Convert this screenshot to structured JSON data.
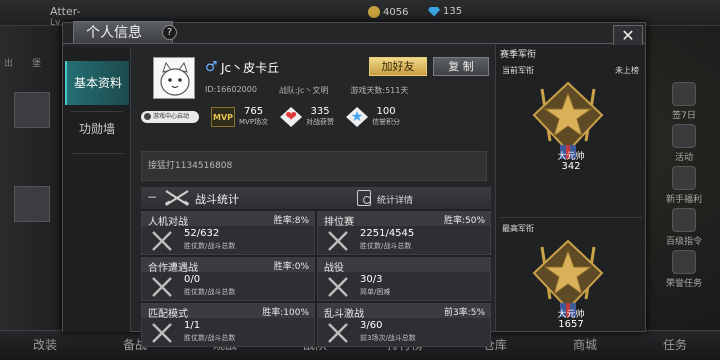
{
  "background": {
    "player_name": "Atter-",
    "player_level": "Lv.",
    "coins": "4056",
    "gems": "135",
    "left_tabs": [
      "出",
      "堡"
    ],
    "right_items": [
      "签7日",
      "活动",
      "新手福利",
      "百级指令",
      "荣誉任务"
    ],
    "bottom_items": [
      "改装",
      "备战",
      "观战",
      "战队",
      "排行榜",
      "仓库",
      "商城",
      "任务"
    ]
  },
  "dialog": {
    "title": "个人信息",
    "help_symbol": "?",
    "close_symbol": "✕",
    "side_tabs": [
      {
        "label": "基本资料",
        "active": true
      },
      {
        "label": "功勋墙",
        "active": false
      }
    ]
  },
  "profile": {
    "gender_symbol": "♂",
    "name": "Jc丶皮卡丘",
    "add_friend_label": "加好友",
    "copy_label": "复 制",
    "id_text": "ID:16602000",
    "team_text": "战队:Jc丶文明",
    "days_text": "游戏天数:511天",
    "center_chip_label": "游戏中心启动",
    "badges": [
      {
        "icon": "mvp-icon",
        "icon_text": "MVP",
        "value": "765",
        "label": "MVP场次"
      },
      {
        "icon": "heart-icon",
        "icon_text": "❤",
        "value": "335",
        "label": "对战获赞"
      },
      {
        "icon": "star-icon",
        "icon_text": "★",
        "value": "100",
        "label": "信誉积分"
      }
    ],
    "signature": "接猛打1134516808"
  },
  "stats": {
    "collapse_symbol": "−",
    "title": "战斗统计",
    "detail_label": "统计详情",
    "cards": [
      {
        "name": "人机对战",
        "rate": "胜率:8%",
        "value": "52/632",
        "sub": "胜仗数/战斗总数"
      },
      {
        "name": "排位赛",
        "rate": "胜率:50%",
        "value": "2251/4545",
        "sub": "胜仗数/战斗总数"
      },
      {
        "name": "合作遭遇战",
        "rate": "胜率:0%",
        "value": "0/0",
        "sub": "胜仗数/战斗总数"
      },
      {
        "name": "战役",
        "rate": "",
        "value": "30/3",
        "sub": "简单/困难"
      },
      {
        "name": "匹配模式",
        "rate": "胜率:100%",
        "value": "1/1",
        "sub": "胜仗数/战斗总数"
      },
      {
        "name": "乱斗激战",
        "rate": "前3率:5%",
        "value": "3/60",
        "sub": "前3场次/战斗总数"
      }
    ]
  },
  "rank": {
    "title": "赛季军衔",
    "current_label": "当前军衔",
    "current_status": "未上榜",
    "current_rank_name": "大元帅",
    "current_score": "342",
    "highest_label": "最高军衔",
    "highest_rank_name": "大元帅",
    "highest_score": "1657"
  },
  "colors": {
    "accent_teal": "#256f73",
    "gold_button": "#d8b45a",
    "emblem_gold": "#c9a24a"
  }
}
